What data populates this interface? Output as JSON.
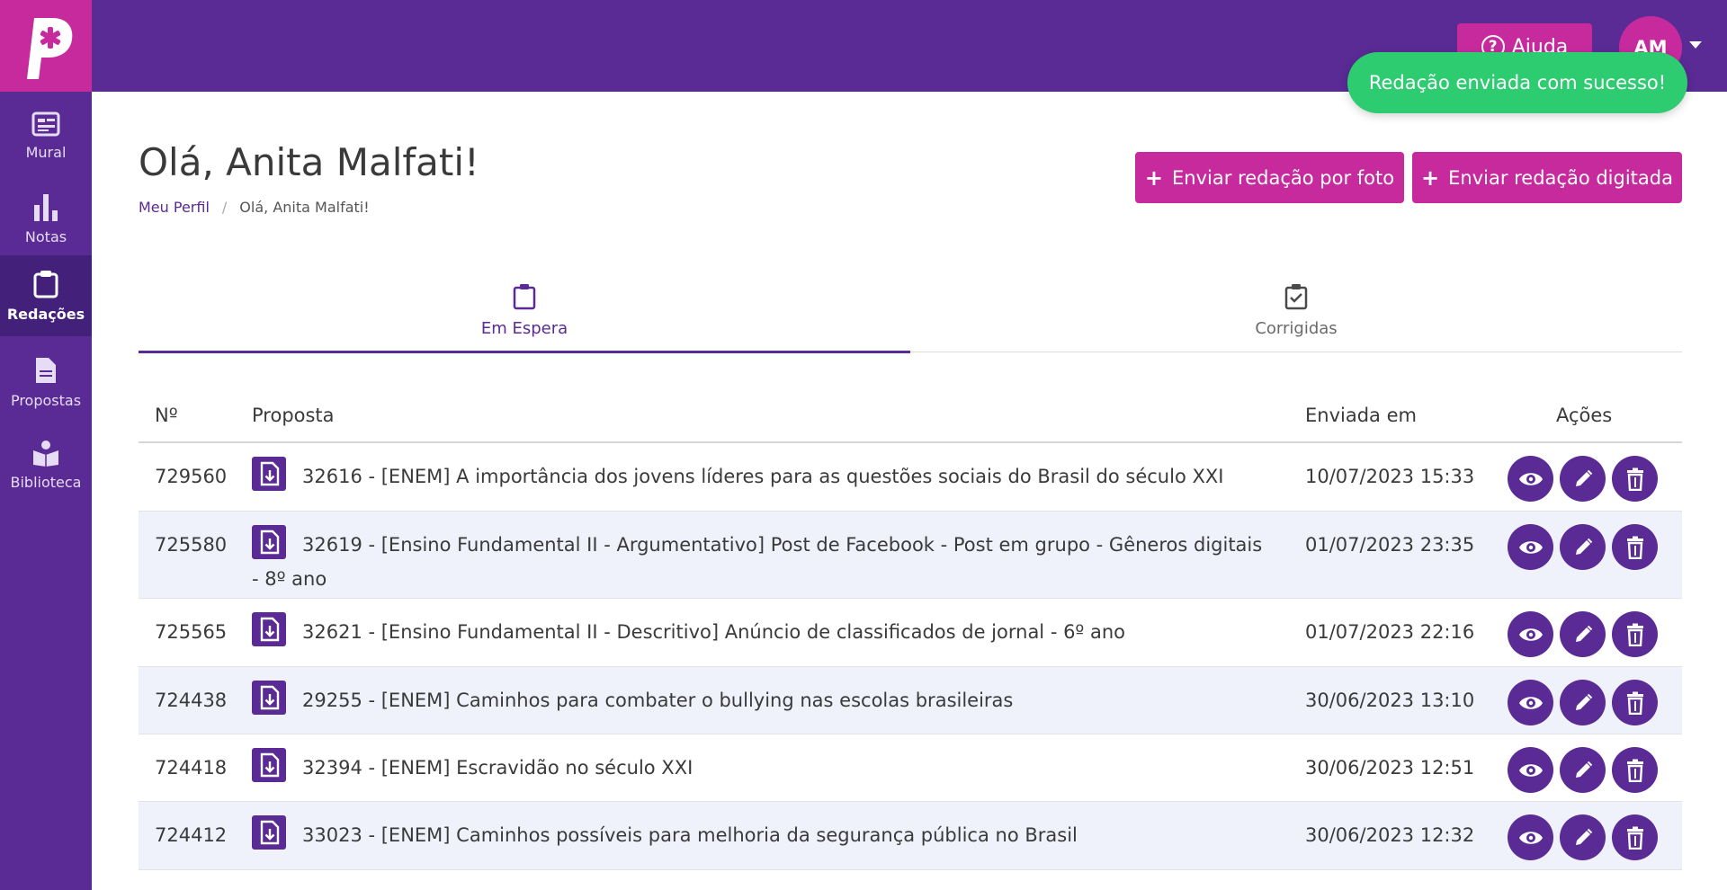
{
  "brand": {
    "logo_letter": "P"
  },
  "header": {
    "help_label": "Ajuda",
    "avatar_initials": "AM"
  },
  "toast": {
    "message": "Redação enviada com sucesso!"
  },
  "sidebar": {
    "items": [
      {
        "label": "Mural",
        "icon": "mural-icon"
      },
      {
        "label": "Notas",
        "icon": "bar-chart-icon"
      },
      {
        "label": "Redações",
        "icon": "clipboard-icon",
        "active": true
      },
      {
        "label": "Propostas",
        "icon": "document-icon"
      },
      {
        "label": "Biblioteca",
        "icon": "book-reader-icon"
      }
    ]
  },
  "page": {
    "title": "Olá, Anita Malfati!",
    "breadcrumb": {
      "parent": "Meu Perfil",
      "separator": "/",
      "current": "Olá, Anita Malfati!"
    },
    "buttons": {
      "photo": "Enviar redação por foto",
      "typed": "Enviar redação digitada"
    }
  },
  "tabs": [
    {
      "label": "Em Espera",
      "active": true
    },
    {
      "label": "Corrigidas",
      "active": false
    }
  ],
  "table": {
    "headers": {
      "number": "Nº",
      "proposal": "Proposta",
      "sent": "Enviada em",
      "actions": "Ações"
    },
    "rows": [
      {
        "number": "729560",
        "proposal": "32616 - [ENEM] A importância dos jovens líderes para as questões sociais do Brasil do século XXI",
        "sent": "10/07/2023 15:33"
      },
      {
        "number": "725580",
        "proposal": "32619 - [Ensino Fundamental II - Argumentativo] Post de Facebook - Post em grupo - Gêneros digitais - 8º ano",
        "sent": "01/07/2023 23:35"
      },
      {
        "number": "725565",
        "proposal": "32621 - [Ensino Fundamental II - Descritivo] Anúncio de classificados de jornal - 6º ano",
        "sent": "01/07/2023 22:16"
      },
      {
        "number": "724438",
        "proposal": "29255 - [ENEM] Caminhos para combater o bullying nas escolas brasileiras",
        "sent": "30/06/2023 13:10"
      },
      {
        "number": "724418",
        "proposal": "32394 - [ENEM] Escravidão no século XXI",
        "sent": "30/06/2023 12:51"
      },
      {
        "number": "724412",
        "proposal": "33023 - [ENEM] Caminhos possíveis para melhoria da segurança pública no Brasil",
        "sent": "30/06/2023 12:32"
      }
    ]
  },
  "colors": {
    "primary": "#5a2a95",
    "accent": "#c72a9d",
    "success": "#2ecc71"
  }
}
